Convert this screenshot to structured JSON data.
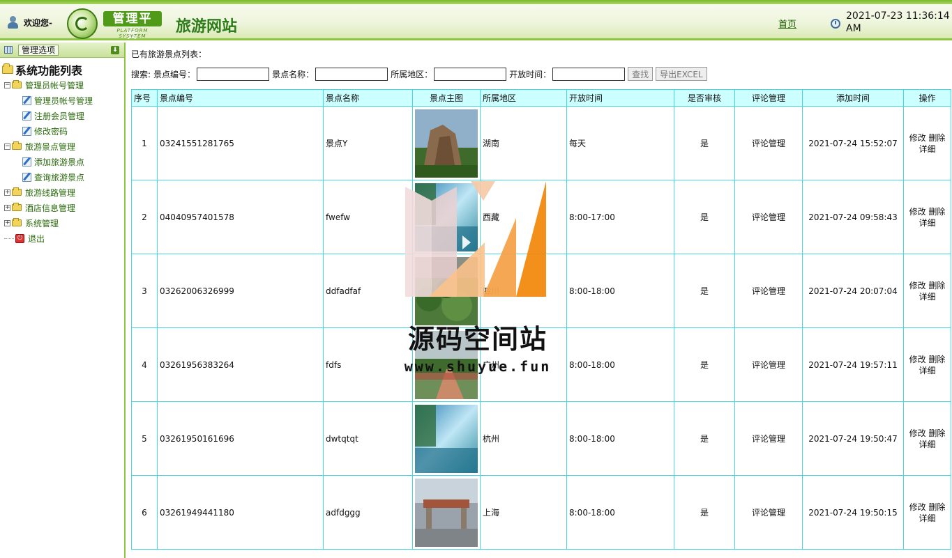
{
  "header": {
    "welcome": "欢迎您-",
    "logo_title": "管理平台",
    "logo_subtitle": "PLATFORM SYSYTEM",
    "site_title": "旅游网站",
    "home_link": "首页",
    "datetime": "2021-07-23 11:36:14 AM"
  },
  "sidebar": {
    "header_label": "管理选项",
    "root_label": "系统功能列表",
    "groups": [
      {
        "label": "管理员帐号管理",
        "expanded": true,
        "children": [
          "管理员帐号管理",
          "注册会员管理",
          "修改密码"
        ]
      },
      {
        "label": "旅游景点管理",
        "expanded": true,
        "children": [
          "添加旅游景点",
          "查询旅游景点"
        ]
      },
      {
        "label": "旅游线路管理",
        "expanded": false,
        "children": []
      },
      {
        "label": "酒店信息管理",
        "expanded": false,
        "children": []
      },
      {
        "label": "系统管理",
        "expanded": false,
        "children": []
      }
    ],
    "exit_label": "退出"
  },
  "main": {
    "list_title": "已有旅游景点列表：",
    "search": {
      "prefix": "搜索:",
      "field1_label": "景点编号：",
      "field2_label": "景点名称：",
      "field3_label": "所属地区：",
      "field4_label": "开放时间：",
      "field1_value": "",
      "field2_value": "",
      "field3_value": "",
      "field4_value": "",
      "search_button": "查找",
      "export_button": "导出EXCEL"
    },
    "table": {
      "headers": [
        "序号",
        "景点编号",
        "景点名称",
        "景点主图",
        "所属地区",
        "开放时间",
        "是否审核",
        "评论管理",
        "添加时间",
        "操作"
      ],
      "rows": [
        {
          "no": "1",
          "code": "03241551281765",
          "name": "景点Y",
          "image": "mountain-rock",
          "region": "湖南",
          "hours": "每天",
          "approved": "是",
          "comment": "评论管理",
          "added": "2021-07-24 15:52:07"
        },
        {
          "no": "2",
          "code": "04040957401578",
          "name": "fwefw",
          "image": "lake-blue",
          "region": "西藏",
          "hours": "8:00-17:00",
          "approved": "是",
          "comment": "评论管理",
          "added": "2021-07-24 09:58:43"
        },
        {
          "no": "3",
          "code": "03262006326999",
          "name": "ddfadfaf",
          "image": "garden-green",
          "region": "四川",
          "hours": "8:00-18:00",
          "approved": "是",
          "comment": "评论管理",
          "added": "2021-07-24 20:07:04"
        },
        {
          "no": "4",
          "code": "03261956383264",
          "name": "fdfs",
          "image": "park-path",
          "region": "广州",
          "hours": "8:00-18:00",
          "approved": "是",
          "comment": "评论管理",
          "added": "2021-07-24 19:57:11"
        },
        {
          "no": "5",
          "code": "03261950161696",
          "name": "dwtqtqt",
          "image": "lake-blue",
          "region": "杭州",
          "hours": "8:00-18:00",
          "approved": "是",
          "comment": "评论管理",
          "added": "2021-07-24 19:50:47"
        },
        {
          "no": "6",
          "code": "03261949441180",
          "name": "adfdggg",
          "image": "gate-plaza",
          "region": "上海",
          "hours": "8:00-18:00",
          "approved": "是",
          "comment": "评论管理",
          "added": "2021-07-24 19:50:15"
        }
      ],
      "ops": {
        "edit": "修改",
        "delete": "删除",
        "detail": "详细"
      }
    }
  },
  "watermark": {
    "text": "源码空间站",
    "url": "www.shuyue.fun"
  },
  "colors": {
    "accent_green": "#8cc63f",
    "table_border": "#46d6e0",
    "table_header_bg": "#ccffff",
    "watermark_orange": "#f28a0f"
  }
}
